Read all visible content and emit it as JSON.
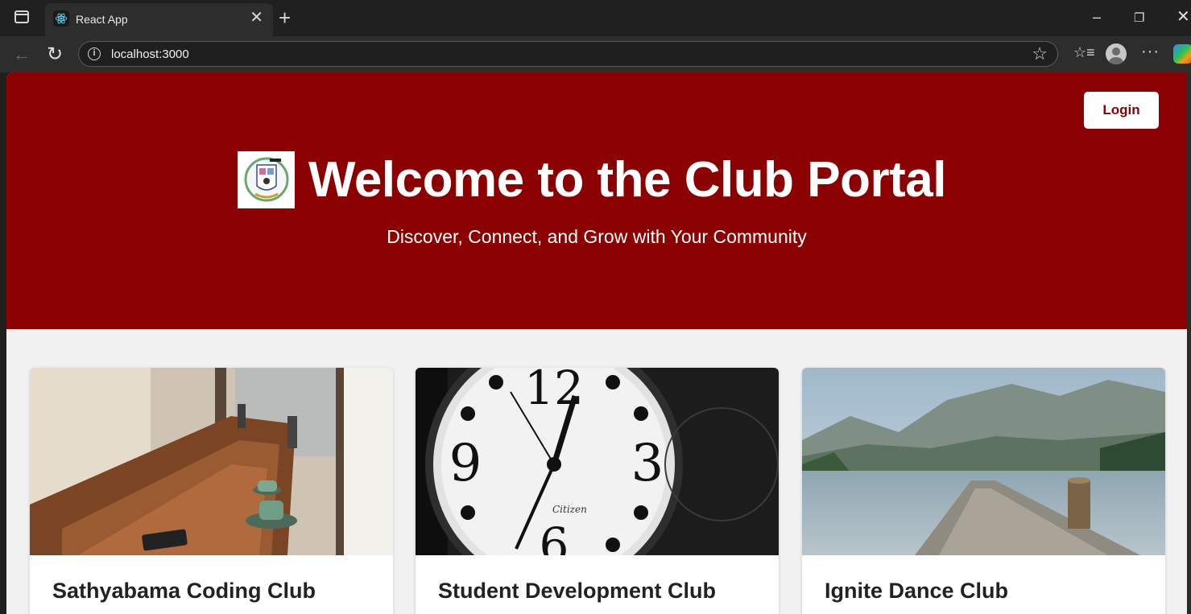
{
  "browser": {
    "tab_title": "React App",
    "url": "localhost:3000",
    "favicon": "react-icon"
  },
  "header": {
    "login_label": "Login",
    "title": "Welcome to the Club Portal",
    "subtitle": "Discover, Connect, and Grow with Your Community",
    "background_color": "#8b0000"
  },
  "clubs": [
    {
      "name": "Sathyabama Coding Club",
      "image": "cafe-table-photo"
    },
    {
      "name": "Student Development Club",
      "image": "clock-photo"
    },
    {
      "name": "Ignite Dance Club",
      "image": "lake-pier-photo"
    }
  ]
}
